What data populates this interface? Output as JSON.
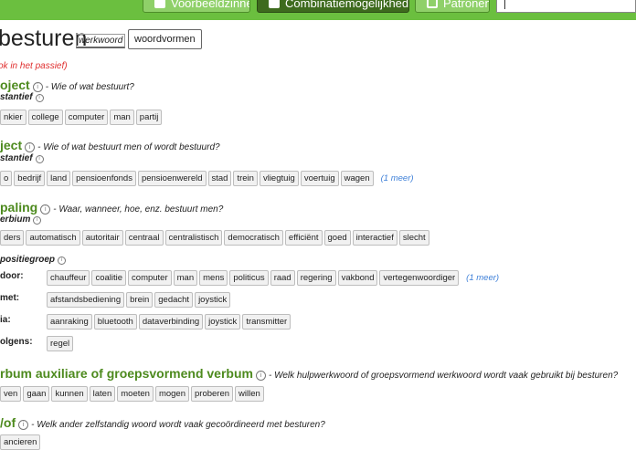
{
  "topnav": {
    "tab1": "Voorbeeldzinnen",
    "tab2": "Combinatiemogelijkheden",
    "tab3": "Patronen",
    "search_value": ""
  },
  "header": {
    "title": "besturen",
    "wordtype": "werkwoord",
    "forms_button": "woordvormen",
    "passive_note": "ok in het passief)"
  },
  "sections": {
    "object1": {
      "title": "oject",
      "question": "- Wie of wat bestuurt?",
      "sub": "stantief",
      "chips": [
        "nkier",
        "college",
        "computer",
        "man",
        "partij"
      ]
    },
    "object2": {
      "title": "ject",
      "question": "- Wie of wat bestuurt men of wordt bestuurd?",
      "sub": "stantief",
      "chips": [
        "o",
        "bedrijf",
        "land",
        "pensioenfonds",
        "pensioenwereld",
        "stad",
        "trein",
        "vliegtuig",
        "voertuig",
        "wagen"
      ],
      "more": "(1 meer)"
    },
    "bepaling": {
      "title": "paling",
      "question": "- Waar, wanneer, hoe, enz. bestuurt men?",
      "sub": "erbium",
      "chips": [
        "ders",
        "automatisch",
        "autoritair",
        "centraal",
        "centralistisch",
        "democratisch",
        "efficiënt",
        "goed",
        "interactief",
        "slecht"
      ]
    },
    "pp": {
      "sub": "positiegroep",
      "door_label": "door:",
      "door_chips": [
        "chauffeur",
        "coalitie",
        "computer",
        "man",
        "mens",
        "politicus",
        "raad",
        "regering",
        "vakbond",
        "vertegenwoordiger"
      ],
      "door_more": "(1 meer)",
      "met_label": "met:",
      "met_chips": [
        "afstandsbediening",
        "brein",
        "gedacht",
        "joystick"
      ],
      "via_label": "ia:",
      "via_chips": [
        "aanraking",
        "bluetooth",
        "dataverbinding",
        "joystick",
        "transmitter"
      ],
      "volgens_label": "olgens:",
      "volgens_chips": [
        "regel"
      ]
    },
    "aux": {
      "title": "rbum auxiliare of groepsvormend verbum",
      "question": "- Welk hulpwerkwoord of groepsvormend werkwoord wordt vaak gebruikt bij besturen?",
      "chips": [
        "ven",
        "gaan",
        "kunnen",
        "laten",
        "moeten",
        "mogen",
        "proberen",
        "willen"
      ]
    },
    "enof": {
      "title": "/of",
      "question": "- Welk ander zelfstandig woord wordt vaak gecoördineerd met besturen?",
      "chips": [
        "ancieren"
      ]
    }
  }
}
